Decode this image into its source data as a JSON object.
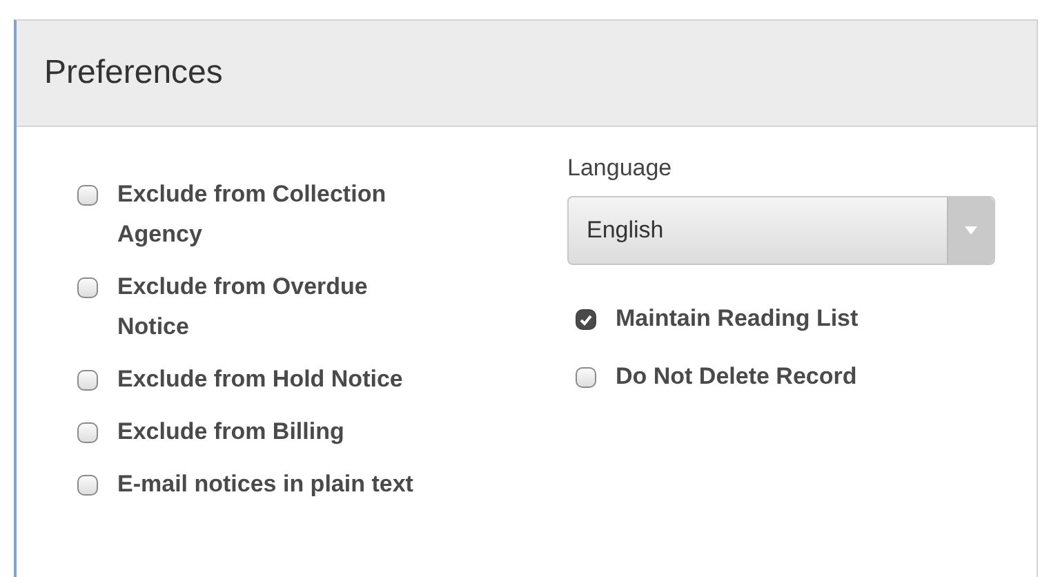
{
  "panel": {
    "title": "Preferences"
  },
  "left_options": [
    {
      "label": "Exclude from Collection Agency",
      "checked": false
    },
    {
      "label": "Exclude from Overdue Notice",
      "checked": false
    },
    {
      "label": "Exclude from Hold Notice",
      "checked": false
    },
    {
      "label": "Exclude from Billing",
      "checked": false
    },
    {
      "label": "E-mail notices in plain text",
      "checked": false
    }
  ],
  "language": {
    "label": "Language",
    "value": "English"
  },
  "right_options": [
    {
      "label": "Maintain Reading List",
      "checked": true
    },
    {
      "label": "Do Not Delete Record",
      "checked": false
    }
  ]
}
